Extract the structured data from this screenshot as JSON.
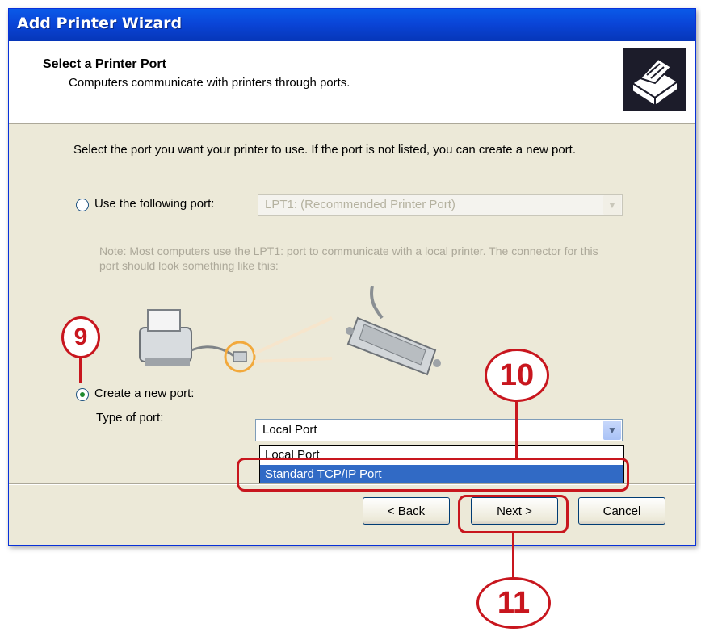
{
  "window": {
    "title": "Add Printer Wizard"
  },
  "header": {
    "title": "Select a Printer Port",
    "subtitle": "Computers communicate with printers through ports.",
    "icon": "printer-icon"
  },
  "instructions": "Select the port you want your printer to use.  If the port is not listed, you can create a new port.",
  "use_port": {
    "label": "Use the following port:",
    "selected": false,
    "value": "LPT1: (Recommended Printer Port)",
    "enabled": false
  },
  "note": "Note: Most computers use the LPT1: port to communicate with a local printer. The connector for this port should look something like this:",
  "create_port": {
    "label": "Create a new port:",
    "selected": true,
    "type_label": "Type of port:",
    "value": "Local Port",
    "options": [
      "Local Port",
      "Standard TCP/IP Port"
    ],
    "highlighted": "Standard TCP/IP Port"
  },
  "buttons": {
    "back": "< Back",
    "next": "Next >",
    "cancel": "Cancel"
  },
  "annotations": {
    "step9": "9",
    "step10": "10",
    "step11": "11"
  },
  "colors": {
    "annotation": "#c8161e",
    "titlebar": "#0a4fe0",
    "selection": "#316ac5"
  }
}
